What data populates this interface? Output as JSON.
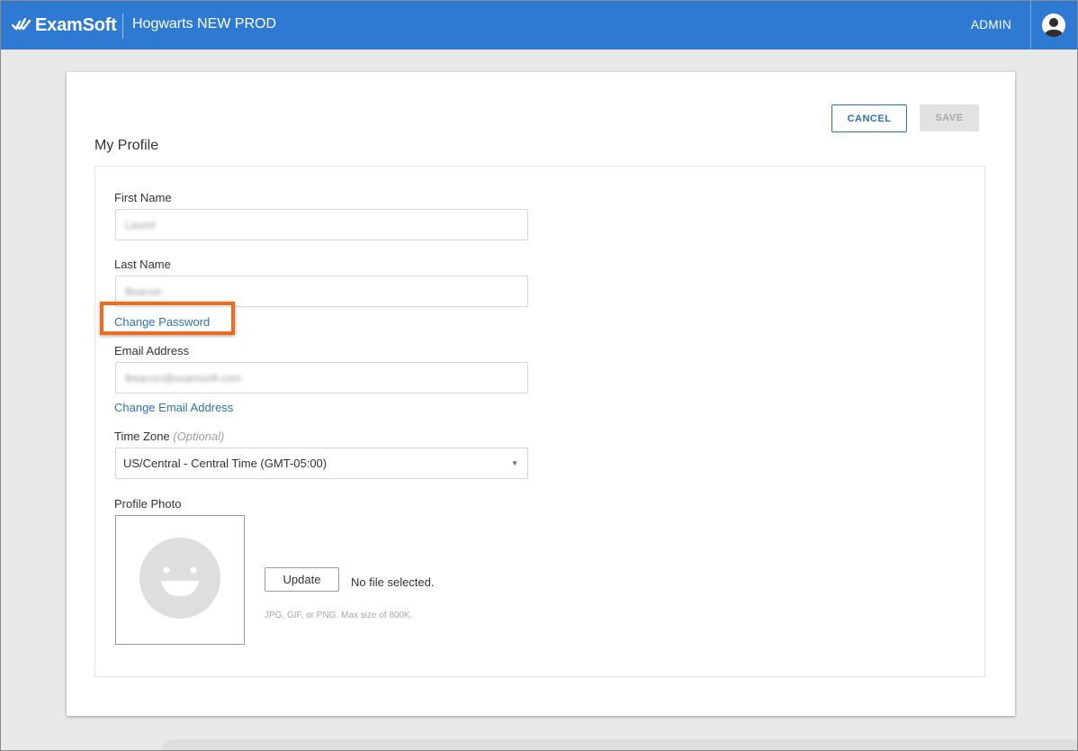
{
  "header": {
    "brand": "ExamSoft",
    "org_name": "Hogwarts NEW PROD",
    "admin_label": "ADMIN",
    "brand_color": "#2e7ad3"
  },
  "actions": {
    "cancel_label": "CANCEL",
    "save_label": "SAVE"
  },
  "page_title": "My Profile",
  "form": {
    "first_name": {
      "label": "First Name",
      "value": "Laurel"
    },
    "last_name": {
      "label": "Last Name",
      "value": "Beacon"
    },
    "change_password_label": "Change Password",
    "email": {
      "label": "Email Address",
      "value": "lbeacon@examsoft.com"
    },
    "change_email_label": "Change Email Address",
    "time_zone": {
      "label": "Time Zone",
      "optional_label": "(Optional)",
      "selected": "US/Central - Central Time (GMT-05:00)"
    },
    "profile_photo": {
      "label": "Profile Photo",
      "update_label": "Update",
      "file_status": "No file selected.",
      "hint": "JPG, GIF, or PNG. Max size of 800K."
    }
  },
  "icons": {
    "logo": "examsoft-check-logo-icon",
    "user": "user-avatar-icon",
    "dropdown": "chevron-down-icon",
    "placeholder": "smiley-face-icon"
  },
  "highlight_color": "#f06b1b"
}
